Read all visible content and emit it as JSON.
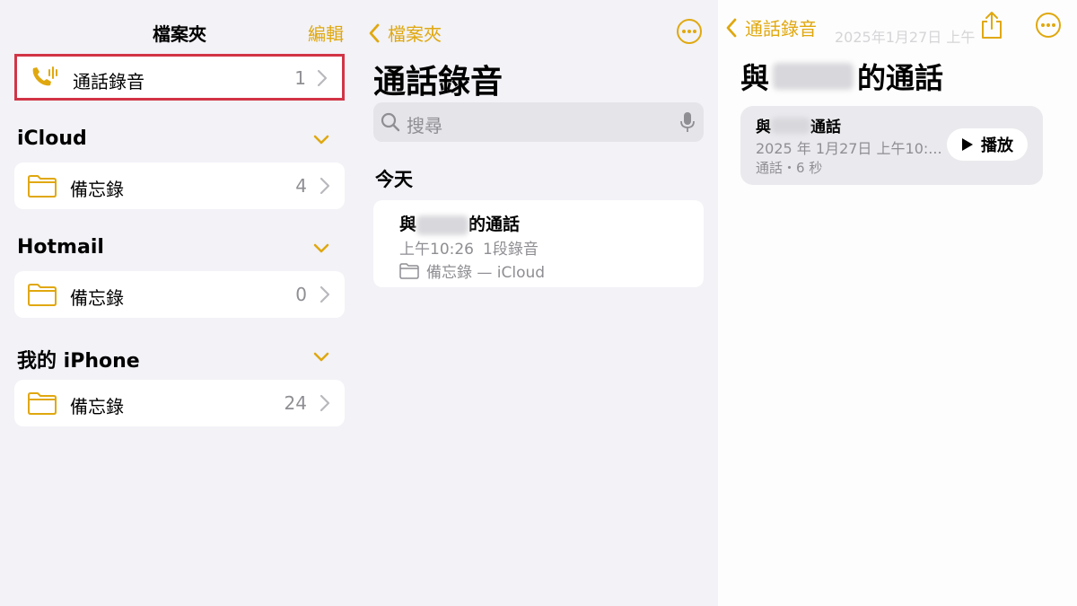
{
  "colors": {
    "accent": "#e0a80f",
    "highlight": "#d23446",
    "secondary_text": "#8e8e93"
  },
  "folders_pane": {
    "title": "檔案夾",
    "edit_label": "編輯",
    "selected_folder": {
      "icon": "phone-waveform-icon",
      "label": "通話錄音",
      "count": "1"
    },
    "sections": [
      {
        "title": "iCloud",
        "folder": {
          "icon": "folder-icon",
          "label": "備忘錄",
          "count": "4"
        }
      },
      {
        "title": "Hotmail",
        "folder": {
          "icon": "folder-icon",
          "label": "備忘錄",
          "count": "0"
        }
      },
      {
        "title": "我的 iPhone",
        "folder": {
          "icon": "folder-icon",
          "label": "備忘錄",
          "count": "24"
        }
      }
    ]
  },
  "list_pane": {
    "back_label": "檔案夾",
    "heading": "通話錄音",
    "search": {
      "placeholder": "搜尋",
      "icon": "search-icon",
      "mic_icon": "microphone-icon"
    },
    "section_today": "今天",
    "note": {
      "title_prefix": "與",
      "title_suffix": "的通話",
      "time": "上午10:26",
      "recordings": "1段錄音",
      "location": "備忘錄 — iCloud"
    }
  },
  "detail_pane": {
    "back_label": "通話錄音",
    "faint_header": "2025年1月27日 上午",
    "heading_prefix": "與",
    "heading_suffix": "的通話",
    "recording": {
      "title_prefix": "與",
      "title_suffix": "通話",
      "date": "2025 年 1月27日 上午10:...",
      "duration": "通話・6 秒",
      "play_label": "播放"
    }
  }
}
